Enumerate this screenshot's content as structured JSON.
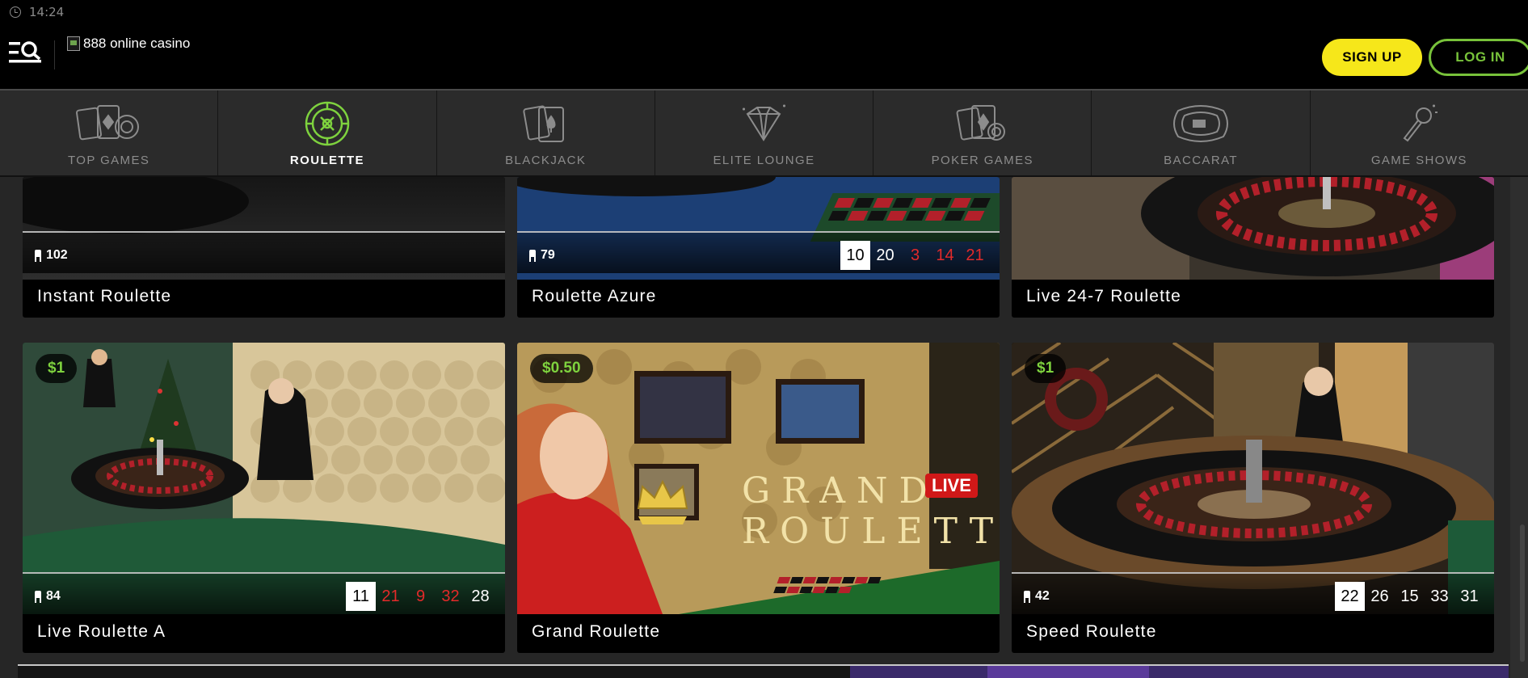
{
  "status": {
    "time": "14:24"
  },
  "header": {
    "logo_alt": "888 online casino",
    "signup_label": "SIGN UP",
    "login_label": "LOG IN"
  },
  "categories": [
    {
      "label": "TOP GAMES",
      "icon": "cards-chips-icon",
      "active": false
    },
    {
      "label": "ROULETTE",
      "icon": "roulette-wheel-icon",
      "active": true
    },
    {
      "label": "BLACKJACK",
      "icon": "playing-cards-icon",
      "active": false
    },
    {
      "label": "ELITE LOUNGE",
      "icon": "diamond-icon",
      "active": false
    },
    {
      "label": "POKER GAMES",
      "icon": "poker-cards-icon",
      "active": false
    },
    {
      "label": "BACCARAT",
      "icon": "baccarat-table-icon",
      "active": false
    },
    {
      "label": "GAME SHOWS",
      "icon": "microphone-icon",
      "active": false
    }
  ],
  "games_row1": [
    {
      "title": "Instant Roulette",
      "players": "102",
      "results": []
    },
    {
      "title": "Roulette Azure",
      "players": "79",
      "results": [
        {
          "n": "10",
          "c": "first"
        },
        {
          "n": "20",
          "c": "blk"
        },
        {
          "n": "3",
          "c": "red"
        },
        {
          "n": "14",
          "c": "red"
        },
        {
          "n": "21",
          "c": "red"
        }
      ]
    },
    {
      "title": "Live 24-7 Roulette",
      "players": "",
      "results": []
    }
  ],
  "games_row2": [
    {
      "title": "Live Roulette A",
      "players": "84",
      "min_bet": "$1",
      "results": [
        {
          "n": "11",
          "c": "first"
        },
        {
          "n": "21",
          "c": "red"
        },
        {
          "n": "9",
          "c": "red"
        },
        {
          "n": "32",
          "c": "red"
        },
        {
          "n": "28",
          "c": "blk"
        }
      ]
    },
    {
      "title": "Grand Roulette",
      "players": "",
      "min_bet": "$0.50",
      "results": [],
      "art_line1": "GRAND",
      "art_line2": "ROULETTE",
      "live_badge": "LIVE"
    },
    {
      "title": "Speed Roulette",
      "players": "42",
      "min_bet": "$1",
      "results": [
        {
          "n": "22",
          "c": "first"
        },
        {
          "n": "26",
          "c": "blk"
        },
        {
          "n": "15",
          "c": "blk"
        },
        {
          "n": "33",
          "c": "blk"
        },
        {
          "n": "31",
          "c": "blk"
        }
      ]
    }
  ]
}
